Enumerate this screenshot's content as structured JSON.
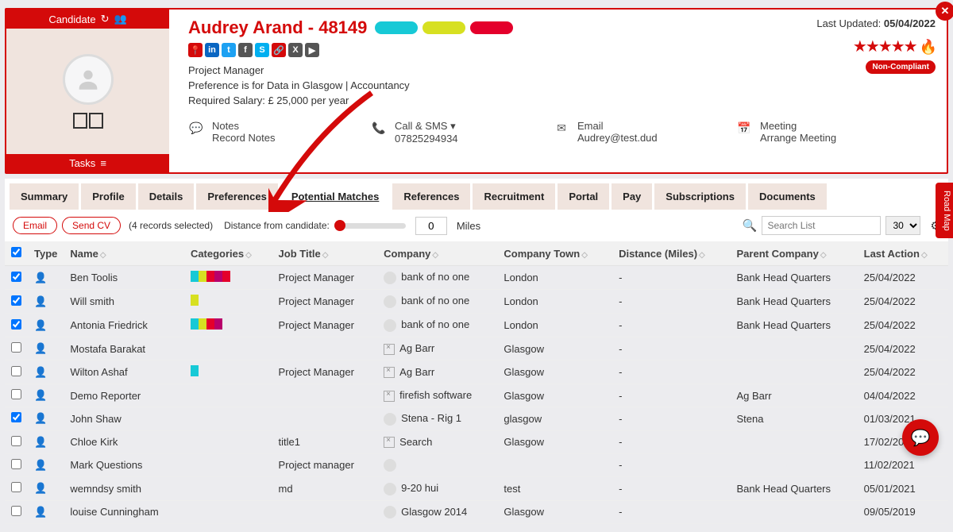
{
  "header": {
    "candidate_label": "Candidate",
    "tasks_label": "Tasks",
    "title": "Audrey Arand - 48149",
    "job_title": "Project Manager",
    "preference_line": "Preference is for Data in Glasgow | Accountancy",
    "salary_line": "Required Salary: £ 25,000 per year",
    "last_updated_label": "Last Updated:",
    "last_updated_value": "05/04/2022",
    "compliance_badge": "Non-Compliant",
    "pills": [
      "#17c9d6",
      "#d7e021",
      "#e4002b"
    ],
    "socials": [
      {
        "name": "map-pin-icon",
        "bg": "#d40a0a",
        "glyph": "📍"
      },
      {
        "name": "linkedin-icon",
        "bg": "#0a66c2",
        "glyph": "in"
      },
      {
        "name": "twitter-icon",
        "bg": "#1da1f2",
        "glyph": "t"
      },
      {
        "name": "facebook-icon",
        "bg": "#555",
        "glyph": "f"
      },
      {
        "name": "skype-icon",
        "bg": "#00aff0",
        "glyph": "S"
      },
      {
        "name": "link-icon",
        "bg": "#d40a0a",
        "glyph": "🔗"
      },
      {
        "name": "xing-icon",
        "bg": "#555",
        "glyph": "X"
      },
      {
        "name": "video-icon",
        "bg": "#555",
        "glyph": "▶"
      }
    ],
    "comm": {
      "notes_label": "Notes",
      "notes_sub": "Record Notes",
      "call_label": "Call & SMS ▾",
      "call_sub": "07825294934",
      "email_label": "Email",
      "email_sub": "Audrey@test.dud",
      "meeting_label": "Meeting",
      "meeting_sub": "Arrange Meeting"
    }
  },
  "tabs": [
    "Summary",
    "Profile",
    "Details",
    "Preferences",
    "Potential Matches",
    "References",
    "Recruitment",
    "Portal",
    "Pay",
    "Subscriptions",
    "Documents"
  ],
  "active_tab": "Potential Matches",
  "toolbar": {
    "email_btn": "Email",
    "sendcv_btn": "Send CV",
    "selected_text": "(4 records selected)",
    "distance_label": "Distance from candidate:",
    "distance_value": "0",
    "miles_label": "Miles",
    "search_placeholder": "Search List",
    "per_page": "30"
  },
  "columns": [
    "",
    "Type",
    "Name",
    "Categories",
    "Job Title",
    "Company",
    "Company Town",
    "Distance (Miles)",
    "Parent Company",
    "Last Action"
  ],
  "rows": [
    {
      "checked": true,
      "name": "Ben Toolis",
      "cats": [
        "#17c9d6",
        "#d7e021",
        "#e4002b",
        "#b8006b",
        "#e4002b"
      ],
      "title": "Project Manager",
      "company": "bank of no one",
      "town": "London",
      "dist": "-",
      "parent": "Bank Head Quarters",
      "last": "25/04/2022",
      "icon": "round"
    },
    {
      "checked": true,
      "name": "Will smith",
      "cats": [
        "#d7e021"
      ],
      "title": "Project Manager",
      "company": "bank of no one",
      "town": "London",
      "dist": "-",
      "parent": "Bank Head Quarters",
      "last": "25/04/2022",
      "icon": "round"
    },
    {
      "checked": true,
      "name": "Antonia Friedrick",
      "cats": [
        "#17c9d6",
        "#d7e021",
        "#e4002b",
        "#b8006b"
      ],
      "title": "Project Manager",
      "company": "bank of no one",
      "town": "London",
      "dist": "-",
      "parent": "Bank Head Quarters",
      "last": "25/04/2022",
      "icon": "round"
    },
    {
      "checked": false,
      "name": "Mostafa Barakat",
      "cats": [],
      "title": "",
      "company": "Ag Barr",
      "town": "Glasgow",
      "dist": "-",
      "parent": "",
      "last": "25/04/2022",
      "icon": "broken"
    },
    {
      "checked": false,
      "name": "Wilton Ashaf",
      "cats": [
        "#17c9d6"
      ],
      "title": "Project Manager",
      "company": "Ag Barr",
      "town": "Glasgow",
      "dist": "-",
      "parent": "",
      "last": "25/04/2022",
      "icon": "broken"
    },
    {
      "checked": false,
      "name": "Demo Reporter",
      "cats": [],
      "title": "",
      "company": "firefish software",
      "town": "Glasgow",
      "dist": "-",
      "parent": "Ag Barr",
      "last": "04/04/2022",
      "icon": "broken"
    },
    {
      "checked": true,
      "name": "John Shaw",
      "cats": [],
      "title": "",
      "company": "Stena - Rig 1",
      "town": "glasgow",
      "dist": "-",
      "parent": "Stena",
      "last": "01/03/2021",
      "icon": "round"
    },
    {
      "checked": false,
      "name": "Chloe Kirk",
      "cats": [],
      "title": "title1",
      "company": "Search",
      "town": "Glasgow",
      "dist": "-",
      "parent": "",
      "last": "17/02/2021",
      "icon": "broken"
    },
    {
      "checked": false,
      "name": "Mark Questions",
      "cats": [],
      "title": "Project manager",
      "company": "",
      "town": "",
      "dist": "-",
      "parent": "",
      "last": "11/02/2021",
      "icon": "round"
    },
    {
      "checked": false,
      "name": "wemndsy smith",
      "cats": [],
      "title": "md",
      "company": "9-20 hui",
      "town": "test",
      "dist": "-",
      "parent": "Bank Head Quarters",
      "last": "05/01/2021",
      "icon": "round"
    },
    {
      "checked": false,
      "name": "louise Cunningham",
      "cats": [],
      "title": "",
      "company": "Glasgow 2014",
      "town": "Glasgow",
      "dist": "-",
      "parent": "",
      "last": "09/05/2019",
      "icon": "round"
    }
  ],
  "roadmap_label": "Road Map"
}
